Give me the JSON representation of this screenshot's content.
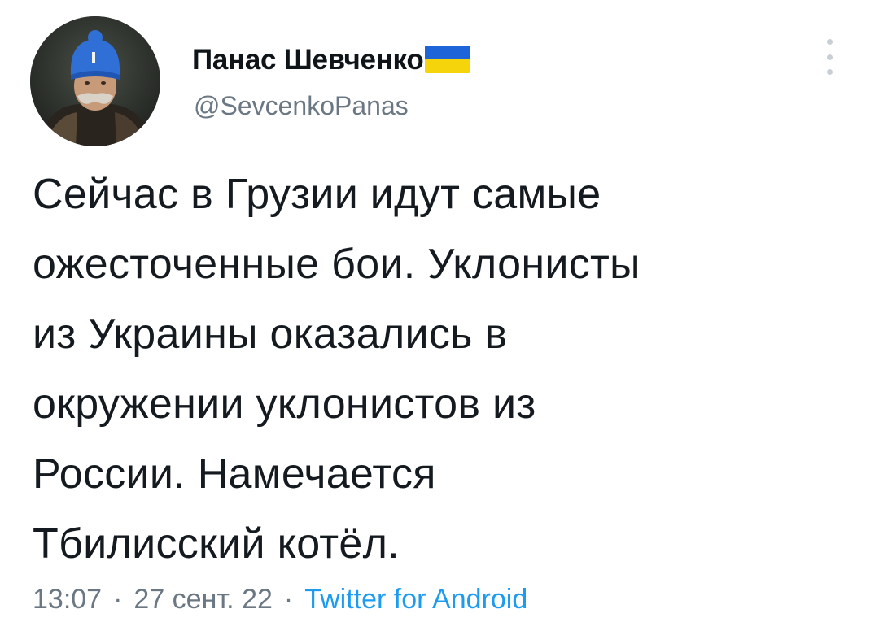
{
  "tweet": {
    "author": {
      "display_name": "Панас Шевченко",
      "handle": "@SevcenkoPanas",
      "flag_icon": "ukraine-flag-icon",
      "avatar": "portrait-avatar"
    },
    "text_lines": [
      "Сейчас в Грузии идут самые",
      "ожесточенные бои. Уклонисты",
      "из Украины оказались в",
      "окружении уклонистов из",
      "России. Намечается",
      "Тбилисский котёл."
    ],
    "meta": {
      "time": "13:07",
      "date": "27 сент. 22",
      "separator": "·",
      "source": "Twitter for Android"
    },
    "more_icon": "more-vertical-icon"
  },
  "colors": {
    "text": "#0f1419",
    "muted": "#6b7884",
    "link": "#1d9bf0",
    "flag_blue": "#1c64d8",
    "flag_yellow": "#f6d40b"
  }
}
